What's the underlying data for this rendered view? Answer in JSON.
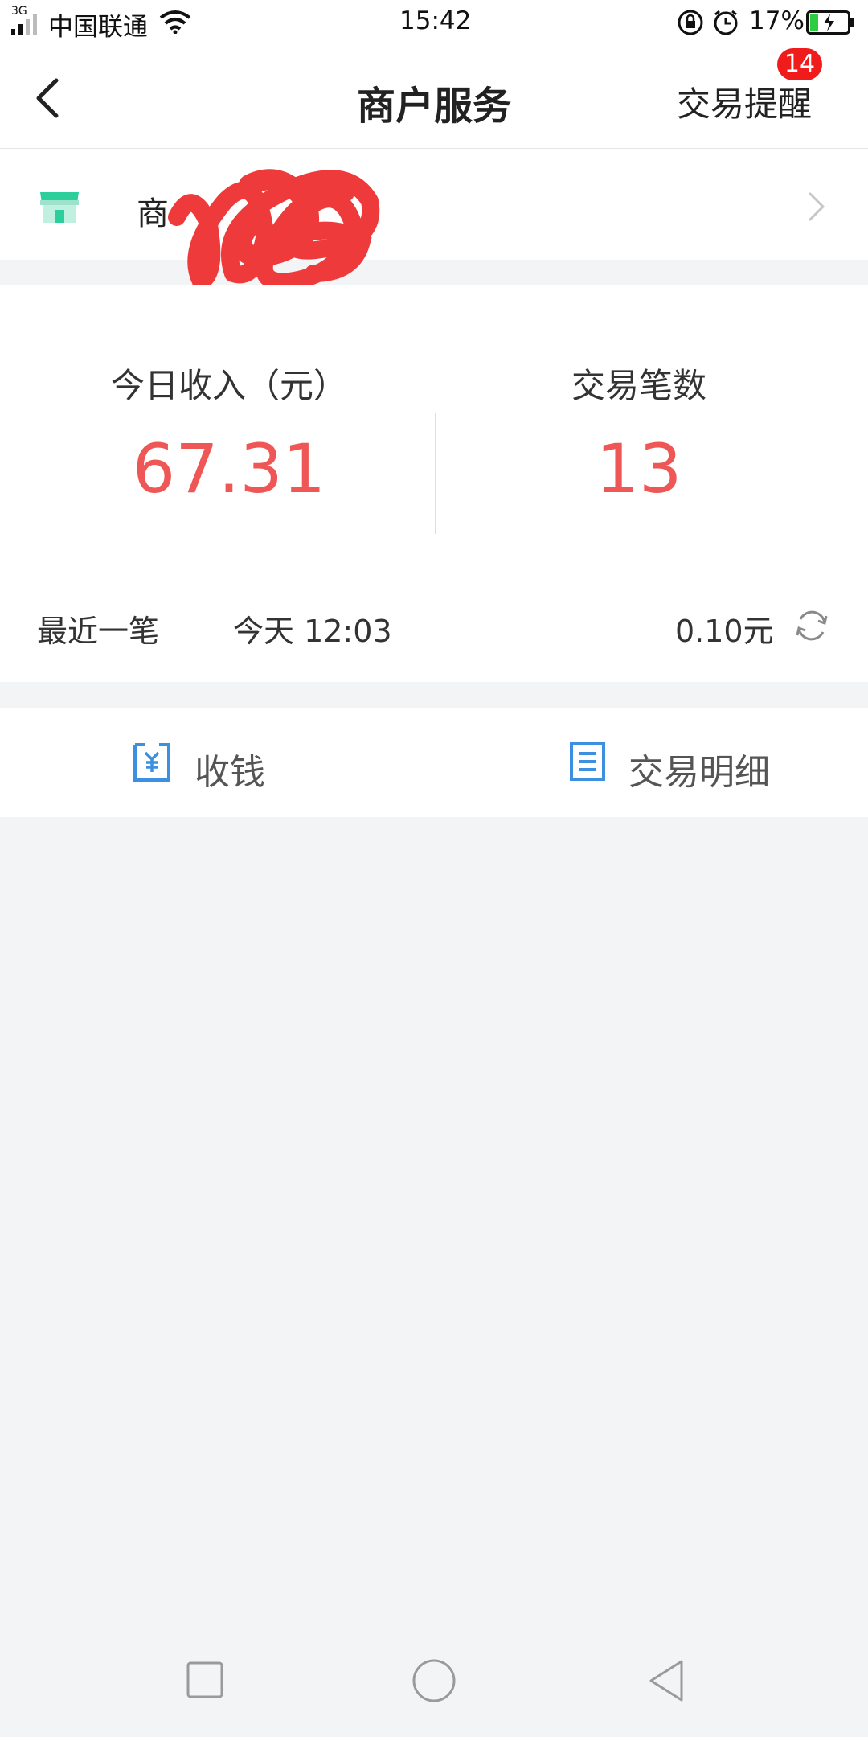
{
  "status_bar": {
    "network": "3G",
    "carrier": "中国联通",
    "time": "15:42",
    "battery": "17%"
  },
  "nav": {
    "title": "商户服务",
    "right_label": "交易提醒",
    "badge_count": "14"
  },
  "merchant": {
    "name_visible": "商"
  },
  "stats": {
    "income_label": "今日收入（元）",
    "income_value": "67.31",
    "count_label": "交易笔数",
    "count_value": "13"
  },
  "recent": {
    "label": "最近一笔",
    "time": "今天 12:03",
    "amount": "0.10元"
  },
  "actions": {
    "collect_label": "收钱",
    "details_label": "交易明细"
  },
  "colors": {
    "accent_red": "#ef5656",
    "icon_blue": "#3d8fe0",
    "store_green": "#2ccf9c"
  }
}
